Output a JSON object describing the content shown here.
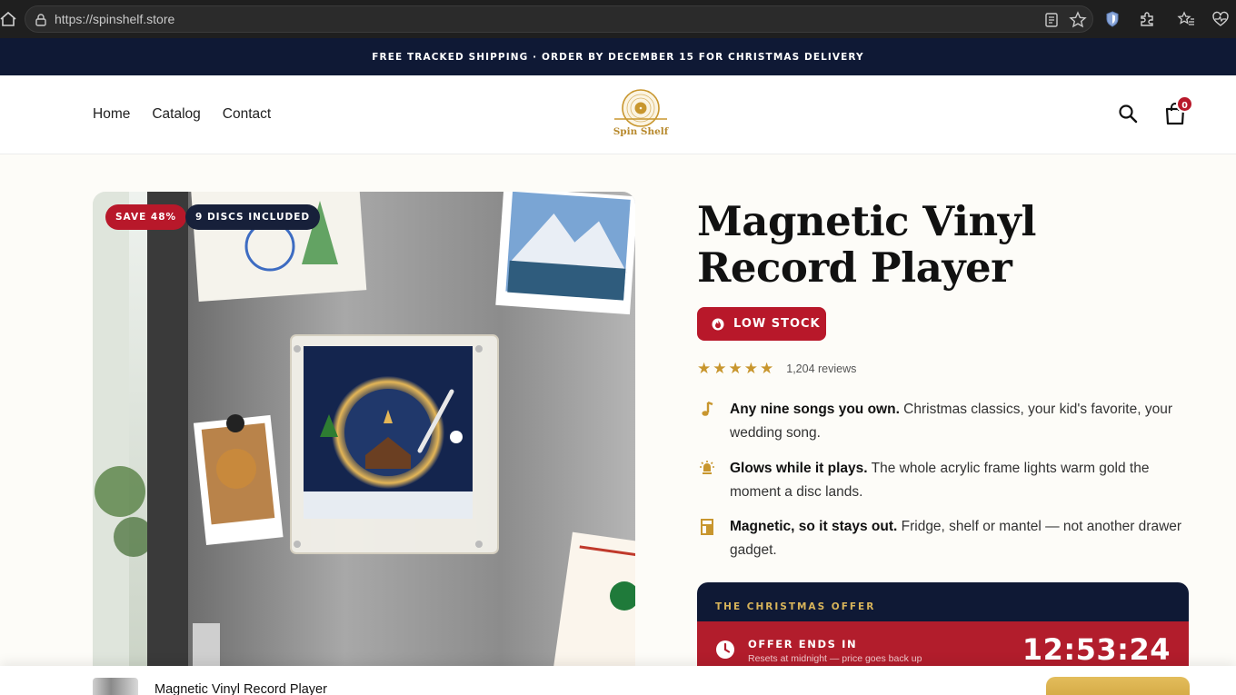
{
  "browser": {
    "url": "https://spinshelf.store"
  },
  "announcement": "FREE TRACKED SHIPPING · ORDER BY DECEMBER 15 FOR CHRISTMAS DELIVERY",
  "nav": {
    "items": [
      "Home",
      "Catalog",
      "Contact"
    ]
  },
  "brand": {
    "name": "Spin Shelf"
  },
  "cart": {
    "count": "0"
  },
  "product": {
    "badges": {
      "save": "SAVE 48%",
      "discs": "9 DISCS INCLUDED"
    },
    "title_line1": "Magnetic Vinyl",
    "title_line2": "Record Player",
    "stock_label": "LOW STOCK",
    "rating": 5,
    "reviews": "1,204 reviews",
    "features": [
      {
        "icon": "music-note-icon",
        "bold": "Any nine songs you own.",
        "text": " Christmas classics, your kid's favorite, your wedding song."
      },
      {
        "icon": "glow-light-icon",
        "bold": "Glows while it plays.",
        "text": " The whole acrylic frame lights warm gold the moment a disc lands."
      },
      {
        "icon": "frame-icon",
        "bold": "Magnetic, so it stays out.",
        "text": " Fridge, shelf or mantel — not another drawer gadget."
      }
    ]
  },
  "offer": {
    "header": "THE CHRISTMAS OFFER",
    "ends_label": "OFFER ENDS IN",
    "resets_note": "Resets at midnight — price goes back up",
    "timer": "12:53:24"
  },
  "sticky": {
    "product_name": "Magnetic Vinyl Record Player"
  },
  "colors": {
    "navy": "#0f1935",
    "red": "#b8182a",
    "gold": "#c8962e",
    "background": "#fdfcf8"
  }
}
